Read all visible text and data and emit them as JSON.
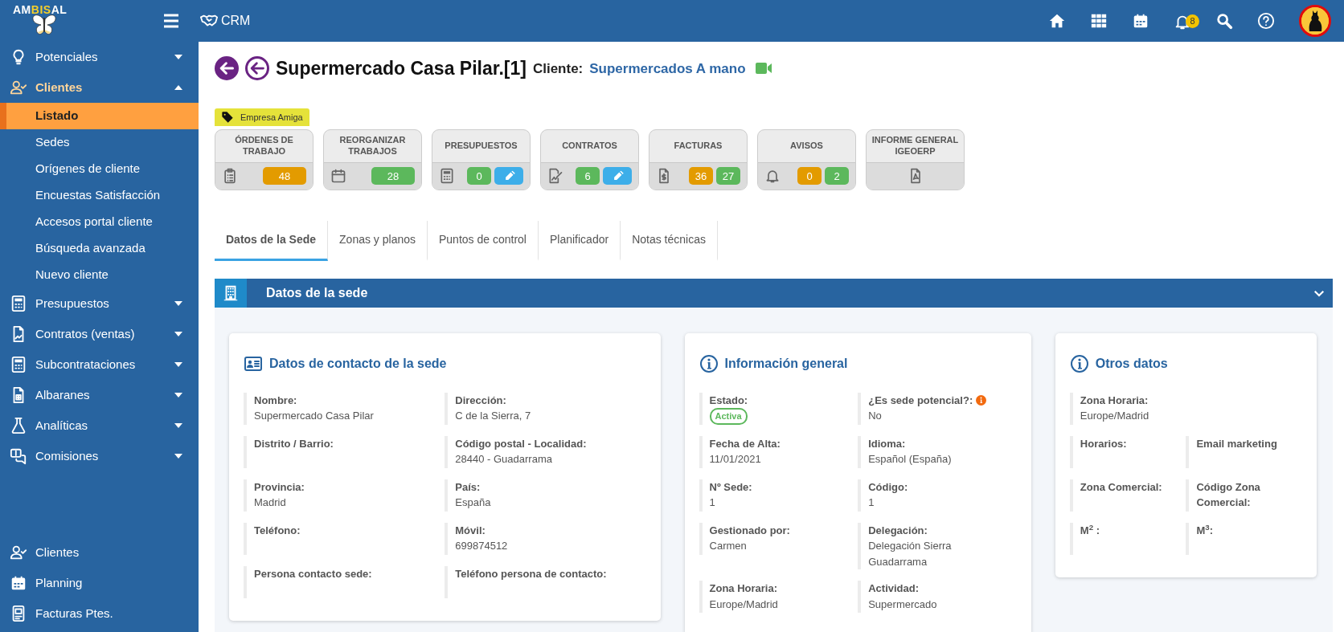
{
  "topbar": {
    "logo_parts": [
      {
        "text": "AM",
        "highlight": false
      },
      {
        "text": "BIS",
        "highlight": true
      },
      {
        "text": "AL",
        "highlight": false
      }
    ],
    "module": "CRM",
    "notifications": "8"
  },
  "sidebar": {
    "items": [
      {
        "label": "Potenciales",
        "expanded": false
      },
      {
        "label": "Clientes",
        "expanded": true,
        "children": [
          {
            "label": "Listado",
            "selected": true
          },
          {
            "label": "Sedes",
            "selected": false
          },
          {
            "label": "Orígenes de cliente",
            "selected": false
          },
          {
            "label": "Encuestas Satisfacción",
            "selected": false
          },
          {
            "label": "Accesos portal cliente",
            "selected": false
          },
          {
            "label": "Búsqueda avanzada",
            "selected": false
          },
          {
            "label": "Nuevo cliente",
            "selected": false
          }
        ]
      },
      {
        "label": "Presupuestos",
        "expanded": false
      },
      {
        "label": "Contratos (ventas)",
        "expanded": false
      },
      {
        "label": "Subcontrataciones",
        "expanded": false
      },
      {
        "label": "Albaranes",
        "expanded": false
      },
      {
        "label": "Analíticas",
        "expanded": false
      },
      {
        "label": "Comisiones",
        "expanded": false
      }
    ],
    "shortcuts": [
      "Clientes",
      "Planning",
      "Facturas Ptes."
    ]
  },
  "header": {
    "title": "Supermercado Casa Pilar.[1]",
    "client_label": "Cliente:",
    "client_name": "Supermercados A mano",
    "tag": "Empresa Amiga"
  },
  "tiles": [
    {
      "title": "ÓRDENES DE TRABAJO",
      "counts": [
        {
          "value": "48",
          "color": "#e39b00"
        }
      ],
      "edit": false
    },
    {
      "title": "REORGANIZAR TRABAJOS",
      "counts": [
        {
          "value": "28",
          "color": "#5cb85c"
        }
      ],
      "edit": false
    },
    {
      "title": "PRESUPUESTOS",
      "counts": [
        {
          "value": "0",
          "color": "#5cb85c"
        }
      ],
      "edit": true
    },
    {
      "title": "CONTRATOS",
      "counts": [
        {
          "value": "6",
          "color": "#5cb85c"
        }
      ],
      "edit": true
    },
    {
      "title": "FACTURAS",
      "counts": [
        {
          "value": "36",
          "color": "#e39b00"
        },
        {
          "value": "27",
          "color": "#5cb85c"
        }
      ],
      "edit": false
    },
    {
      "title": "AVISOS",
      "counts": [
        {
          "value": "0",
          "color": "#e39b00"
        },
        {
          "value": "2",
          "color": "#5cb85c"
        }
      ],
      "edit": false
    },
    {
      "title": "INFORME GENERAL IGEOERP",
      "edit": false
    }
  ],
  "tabs": [
    {
      "label": "Datos de la Sede",
      "selected": true
    },
    {
      "label": "Zonas y planos",
      "selected": false
    },
    {
      "label": "Puntos de control",
      "selected": false
    },
    {
      "label": "Planificador",
      "selected": false
    },
    {
      "label": "Notas técnicas",
      "selected": false
    }
  ],
  "panel": {
    "title": "Datos de la sede",
    "expanded": true,
    "cards": [
      {
        "title": "Datos de contacto de la sede",
        "rows": [
          [
            {
              "label": "Nombre:",
              "value": "Supermercado Casa Pilar"
            },
            {
              "label": "Dirección:",
              "value": "C de la Sierra, 7"
            }
          ],
          [
            {
              "label": "Distrito / Barrio:"
            },
            {
              "label": "Código postal - Localidad:",
              "value": "28440 - Guadarrama"
            }
          ],
          [
            {
              "label": "Provincia:",
              "value": "Madrid"
            },
            {
              "label": "País:",
              "value": "España"
            }
          ],
          [
            {
              "label": "Teléfono:"
            },
            {
              "label": "Móvil:",
              "value": "699874512"
            }
          ],
          [
            {
              "label": "Persona contacto sede:"
            },
            {
              "label": "Teléfono persona de contacto:"
            }
          ]
        ]
      },
      {
        "title": "Información general",
        "rows": [
          [
            {
              "label": "Estado:",
              "status": "Activa"
            },
            {
              "label": "¿Es sede potencial?:",
              "value": "No",
              "info": true
            }
          ],
          [
            {
              "label": "Fecha de Alta:",
              "value": "11/01/2021"
            },
            {
              "label": "Idioma:",
              "value": "Español (España)"
            }
          ],
          [
            {
              "label": "Nº Sede:",
              "value": "1"
            },
            {
              "label": "Código:",
              "value": "1"
            }
          ],
          [
            {
              "label": "Gestionado por:",
              "value": "Carmen"
            },
            {
              "label": "Delegación:",
              "value": "Delegación Sierra Guadarrama"
            }
          ],
          [
            {
              "label": "Zona Horaria:",
              "value": "Europe/Madrid"
            },
            {
              "label": "Actividad:",
              "value": "Supermercado"
            }
          ]
        ]
      },
      {
        "title": "Otros datos",
        "rows": [
          [
            {
              "label": "Zona Horaria:",
              "value": "Europe/Madrid"
            }
          ],
          [
            {
              "label": "Horarios:"
            },
            {
              "label": "Email marketing"
            }
          ],
          [
            {
              "label": "Zona Comercial:"
            },
            {
              "label": "Código Zona Comercial:"
            }
          ],
          [
            {
              "label": "M$^{2}$ :"
            },
            {
              "label": "M$^{3}$:"
            }
          ]
        ]
      }
    ]
  }
}
